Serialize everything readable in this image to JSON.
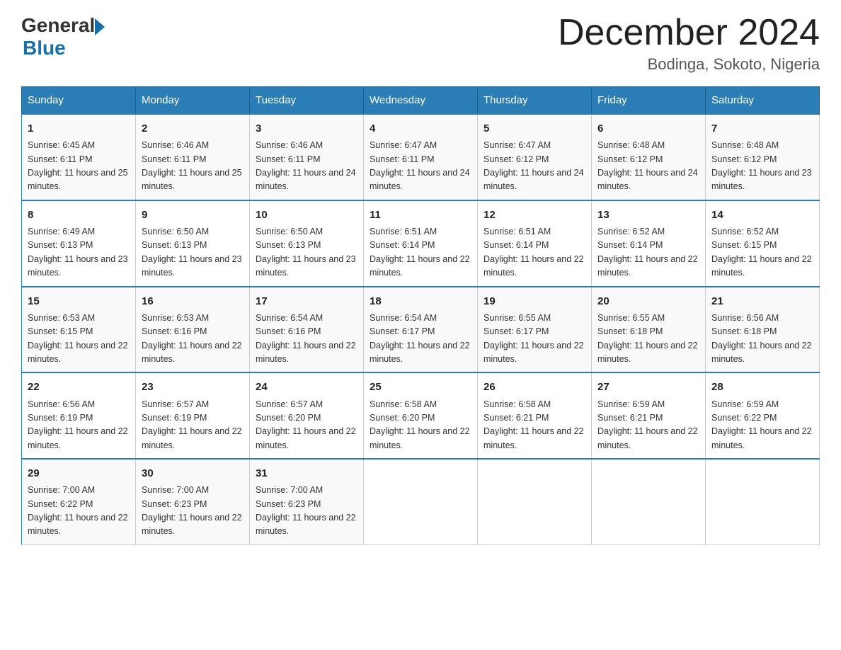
{
  "logo": {
    "general": "General",
    "blue": "Blue"
  },
  "title": "December 2024",
  "location": "Bodinga, Sokoto, Nigeria",
  "weekdays": [
    "Sunday",
    "Monday",
    "Tuesday",
    "Wednesday",
    "Thursday",
    "Friday",
    "Saturday"
  ],
  "weeks": [
    [
      {
        "day": 1,
        "sunrise": "6:45 AM",
        "sunset": "6:11 PM",
        "daylight": "11 hours and 25 minutes."
      },
      {
        "day": 2,
        "sunrise": "6:46 AM",
        "sunset": "6:11 PM",
        "daylight": "11 hours and 25 minutes."
      },
      {
        "day": 3,
        "sunrise": "6:46 AM",
        "sunset": "6:11 PM",
        "daylight": "11 hours and 24 minutes."
      },
      {
        "day": 4,
        "sunrise": "6:47 AM",
        "sunset": "6:11 PM",
        "daylight": "11 hours and 24 minutes."
      },
      {
        "day": 5,
        "sunrise": "6:47 AM",
        "sunset": "6:12 PM",
        "daylight": "11 hours and 24 minutes."
      },
      {
        "day": 6,
        "sunrise": "6:48 AM",
        "sunset": "6:12 PM",
        "daylight": "11 hours and 24 minutes."
      },
      {
        "day": 7,
        "sunrise": "6:48 AM",
        "sunset": "6:12 PM",
        "daylight": "11 hours and 23 minutes."
      }
    ],
    [
      {
        "day": 8,
        "sunrise": "6:49 AM",
        "sunset": "6:13 PM",
        "daylight": "11 hours and 23 minutes."
      },
      {
        "day": 9,
        "sunrise": "6:50 AM",
        "sunset": "6:13 PM",
        "daylight": "11 hours and 23 minutes."
      },
      {
        "day": 10,
        "sunrise": "6:50 AM",
        "sunset": "6:13 PM",
        "daylight": "11 hours and 23 minutes."
      },
      {
        "day": 11,
        "sunrise": "6:51 AM",
        "sunset": "6:14 PM",
        "daylight": "11 hours and 22 minutes."
      },
      {
        "day": 12,
        "sunrise": "6:51 AM",
        "sunset": "6:14 PM",
        "daylight": "11 hours and 22 minutes."
      },
      {
        "day": 13,
        "sunrise": "6:52 AM",
        "sunset": "6:14 PM",
        "daylight": "11 hours and 22 minutes."
      },
      {
        "day": 14,
        "sunrise": "6:52 AM",
        "sunset": "6:15 PM",
        "daylight": "11 hours and 22 minutes."
      }
    ],
    [
      {
        "day": 15,
        "sunrise": "6:53 AM",
        "sunset": "6:15 PM",
        "daylight": "11 hours and 22 minutes."
      },
      {
        "day": 16,
        "sunrise": "6:53 AM",
        "sunset": "6:16 PM",
        "daylight": "11 hours and 22 minutes."
      },
      {
        "day": 17,
        "sunrise": "6:54 AM",
        "sunset": "6:16 PM",
        "daylight": "11 hours and 22 minutes."
      },
      {
        "day": 18,
        "sunrise": "6:54 AM",
        "sunset": "6:17 PM",
        "daylight": "11 hours and 22 minutes."
      },
      {
        "day": 19,
        "sunrise": "6:55 AM",
        "sunset": "6:17 PM",
        "daylight": "11 hours and 22 minutes."
      },
      {
        "day": 20,
        "sunrise": "6:55 AM",
        "sunset": "6:18 PM",
        "daylight": "11 hours and 22 minutes."
      },
      {
        "day": 21,
        "sunrise": "6:56 AM",
        "sunset": "6:18 PM",
        "daylight": "11 hours and 22 minutes."
      }
    ],
    [
      {
        "day": 22,
        "sunrise": "6:56 AM",
        "sunset": "6:19 PM",
        "daylight": "11 hours and 22 minutes."
      },
      {
        "day": 23,
        "sunrise": "6:57 AM",
        "sunset": "6:19 PM",
        "daylight": "11 hours and 22 minutes."
      },
      {
        "day": 24,
        "sunrise": "6:57 AM",
        "sunset": "6:20 PM",
        "daylight": "11 hours and 22 minutes."
      },
      {
        "day": 25,
        "sunrise": "6:58 AM",
        "sunset": "6:20 PM",
        "daylight": "11 hours and 22 minutes."
      },
      {
        "day": 26,
        "sunrise": "6:58 AM",
        "sunset": "6:21 PM",
        "daylight": "11 hours and 22 minutes."
      },
      {
        "day": 27,
        "sunrise": "6:59 AM",
        "sunset": "6:21 PM",
        "daylight": "11 hours and 22 minutes."
      },
      {
        "day": 28,
        "sunrise": "6:59 AM",
        "sunset": "6:22 PM",
        "daylight": "11 hours and 22 minutes."
      }
    ],
    [
      {
        "day": 29,
        "sunrise": "7:00 AM",
        "sunset": "6:22 PM",
        "daylight": "11 hours and 22 minutes."
      },
      {
        "day": 30,
        "sunrise": "7:00 AM",
        "sunset": "6:23 PM",
        "daylight": "11 hours and 22 minutes."
      },
      {
        "day": 31,
        "sunrise": "7:00 AM",
        "sunset": "6:23 PM",
        "daylight": "11 hours and 22 minutes."
      },
      null,
      null,
      null,
      null
    ]
  ],
  "labels": {
    "sunrise_prefix": "Sunrise: ",
    "sunset_prefix": "Sunset: ",
    "daylight_prefix": "Daylight: "
  }
}
